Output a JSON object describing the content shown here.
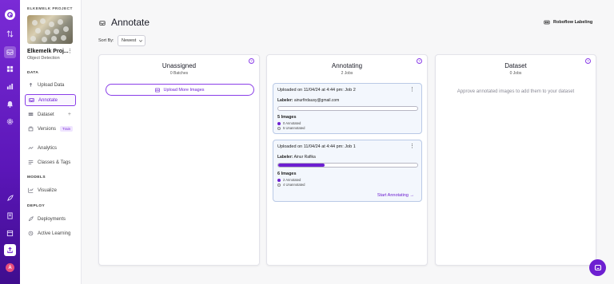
{
  "colors": {
    "brand": "#6d1fd1",
    "rail_top": "#7a2bd6",
    "rail_bottom": "#3f0d8e",
    "annotated": "#6d1fd1"
  },
  "rail": {
    "icons": [
      "logo-icon",
      "swap-icon",
      "inbox-icon",
      "grid-icon",
      "chart-icon",
      "bell-icon",
      "settings-icon",
      "rocket-icon",
      "book-icon",
      "docs-icon",
      "upload-icon"
    ],
    "avatar_initial": "A"
  },
  "sidebar": {
    "project_label": "ELKEMELK PROJECT",
    "project_name": "Elkemelk Proj...",
    "project_type": "Object Detection",
    "sections": {
      "data": "DATA",
      "models": "MODELS",
      "deploy": "DEPLOY"
    },
    "items": [
      {
        "label": "Upload Data",
        "icon": "upload-icon"
      },
      {
        "label": "Annotate",
        "icon": "annotate-icon"
      },
      {
        "label": "Dataset",
        "icon": "dataset-icon",
        "extra": "+"
      },
      {
        "label": "Versions",
        "icon": "versions-icon",
        "badge": "Train"
      },
      {
        "label": "Analytics",
        "icon": "analytics-icon"
      },
      {
        "label": "Classes & Tags",
        "icon": "tags-icon"
      },
      {
        "label": "Visualize",
        "icon": "visualize-icon"
      },
      {
        "label": "Deployments",
        "icon": "deployments-icon"
      },
      {
        "label": "Active Learning",
        "icon": "active-learning-icon"
      }
    ]
  },
  "header": {
    "title": "Annotate",
    "roboflow_labeling": "Roboflow Labeling",
    "sort_label": "Sort By:",
    "sort_value": "Newest"
  },
  "columns": {
    "unassigned": {
      "title": "Unassigned",
      "subtitle": "0 Batches",
      "upload_label": "Upload More Images"
    },
    "annotating": {
      "title": "Annotating",
      "subtitle": "2 Jobs",
      "jobs": [
        {
          "title": "Uploaded on 11/04/24 at 4:44 pm: Job 2",
          "labeler_key": "Labeler:",
          "labeler": "ainurfirdausy@gmail.com",
          "progress": 0,
          "images": "5 Images",
          "annotated": "0 Annotated",
          "unannotated": "5 Unannotated"
        },
        {
          "title": "Uploaded on 11/04/24 at 4:44 pm: Job 1",
          "labeler_key": "Labeler:",
          "labeler": "Ainur Rafika",
          "progress": 0.333,
          "images": "6 Images",
          "annotated": "2 Annotated",
          "unannotated": "4 Unannotated",
          "start_label": "Start Annotating →"
        }
      ]
    },
    "dataset": {
      "title": "Dataset",
      "subtitle": "0 Jobs",
      "empty_message": "Approve annotated images to add them to your dataset"
    }
  }
}
